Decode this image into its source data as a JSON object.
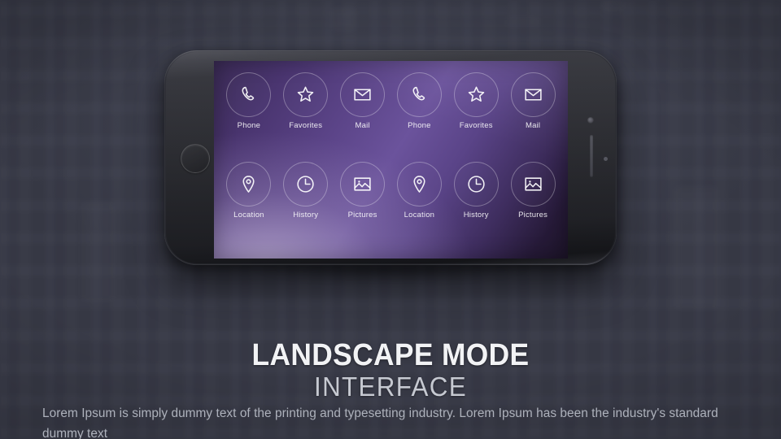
{
  "background": {
    "color": "#383a47",
    "description": "blurred dark city skyline backdrop"
  },
  "device": {
    "name": "smartphone-landscape",
    "body_color": "#2a2b31",
    "hardware": {
      "home_button": "home-button",
      "camera": "camera-dot",
      "speaker": "speaker-slot",
      "sensor": "sensor-dot"
    }
  },
  "screen": {
    "gradient_from": "#1d1429",
    "gradient_mid": "#6b539c",
    "gradient_to": "#b6a8cd",
    "apps": [
      {
        "label": "Phone",
        "icon": "phone-icon"
      },
      {
        "label": "Favorites",
        "icon": "star-icon"
      },
      {
        "label": "Mail",
        "icon": "mail-icon"
      },
      {
        "label": "Phone",
        "icon": "phone-icon"
      },
      {
        "label": "Favorites",
        "icon": "star-icon"
      },
      {
        "label": "Mail",
        "icon": "mail-icon"
      },
      {
        "label": "Location",
        "icon": "map-pin-icon"
      },
      {
        "label": "History",
        "icon": "clock-icon"
      },
      {
        "label": "Pictures",
        "icon": "picture-icon"
      },
      {
        "label": "Location",
        "icon": "map-pin-icon"
      },
      {
        "label": "History",
        "icon": "clock-icon"
      },
      {
        "label": "Pictures",
        "icon": "picture-icon"
      }
    ]
  },
  "caption": {
    "title": "LANDSCAPE MODE",
    "subtitle": "INTERFACE",
    "title_color": "#f2f3f5",
    "subtitle_color": "#c6c9d1",
    "body": "Lorem Ipsum is simply dummy text of the printing and typesetting industry. Lorem Ipsum has been the industry's standard dummy text",
    "body_color": "#aeb2bc"
  }
}
